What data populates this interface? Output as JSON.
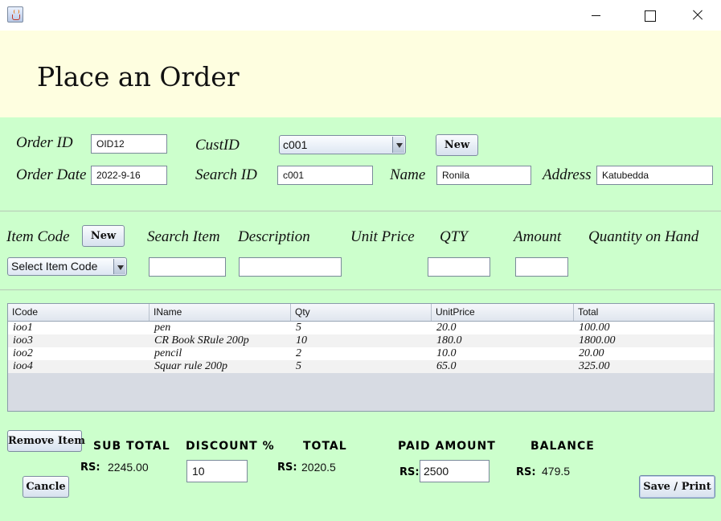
{
  "window": {
    "icon": "java-cup-icon"
  },
  "header": {
    "title": "Place an Order"
  },
  "order": {
    "order_id_label": "Order ID",
    "order_id_value": "OID12",
    "cust_id_label": "CustID",
    "cust_id_selected": "c001",
    "new_button": "New",
    "order_date_label": "Order Date",
    "order_date_value": "2022-9-16",
    "search_id_label": "Search ID",
    "search_id_value": "c001",
    "name_label": "Name",
    "name_value": "Ronila",
    "address_label": "Address",
    "address_value": "Katubedda"
  },
  "item": {
    "item_code_label": "Item Code",
    "new_button": "New",
    "item_code_selected": "Select Item Code",
    "search_item_label": "Search Item",
    "description_label": "Description",
    "unit_price_label": "Unit Price",
    "qty_label": "QTY",
    "amount_label": "Amount",
    "qoh_label": "Quantity on Hand",
    "search_item_value": "",
    "description_value": "",
    "qty_value": "",
    "amount_value": ""
  },
  "table": {
    "columns": [
      "ICode",
      "IName",
      "Qty",
      "UnitPrice",
      "Total"
    ],
    "rows": [
      [
        "ioo1",
        "pen",
        "5",
        "20.0",
        "100.00"
      ],
      [
        "ioo3",
        "CR Book SRule 200p",
        "10",
        "180.0",
        "1800.00"
      ],
      [
        "ioo2",
        "pencil",
        "2",
        "10.0",
        "20.00"
      ],
      [
        "ioo4",
        "Squar rule 200p",
        "5",
        "65.0",
        "325.00"
      ]
    ]
  },
  "summary": {
    "remove_item_button": "Remove Item",
    "cancel_button": "Cancle",
    "save_button": "Save / Print",
    "sub_total_label": "SUB TOTAL",
    "discount_label": "DISCOUNT %",
    "total_label": "TOTAL",
    "paid_amount_label": "PAID AMOUNT",
    "balance_label": "BALANCE",
    "currency": "RS:",
    "sub_total_value": "2245.00",
    "discount_value": "10",
    "total_value": "2020.5",
    "paid_amount_value": "2500",
    "balance_value": "479.5"
  }
}
